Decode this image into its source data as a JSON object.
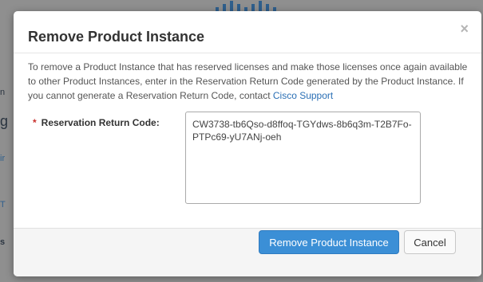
{
  "background": {
    "logo": "cisco-logo",
    "edge_chars": [
      {
        "text": "n",
        "link": false
      },
      {
        "text": "g",
        "link": false
      },
      {
        "text": "ir",
        "link": true
      },
      {
        "text": "T",
        "link": true
      },
      {
        "text": "s",
        "link": false
      }
    ]
  },
  "dialog": {
    "title": "Remove Product Instance",
    "close_label": "×",
    "description": "To remove a Product Instance that has reserved licenses and make those licenses once again available to other Product Instances, enter in the Reservation Return Code generated by the Product Instance. If you cannot generate a Reservation Return Code, contact ",
    "support_link": "Cisco Support",
    "field": {
      "required_marker": "*",
      "label": "Reservation Return Code:",
      "value": "CW3738-tb6Qso-d8ffoq-TGYdws-8b6q3m-T2B7Fo-PTPc69-yU7ANj-oeh"
    },
    "buttons": {
      "primary": "Remove Product Instance",
      "cancel": "Cancel"
    }
  },
  "colors": {
    "primary": "#3b8fd6",
    "link": "#2a6fb5",
    "required": "#c9302c",
    "overlay": "#8f8f8f"
  }
}
